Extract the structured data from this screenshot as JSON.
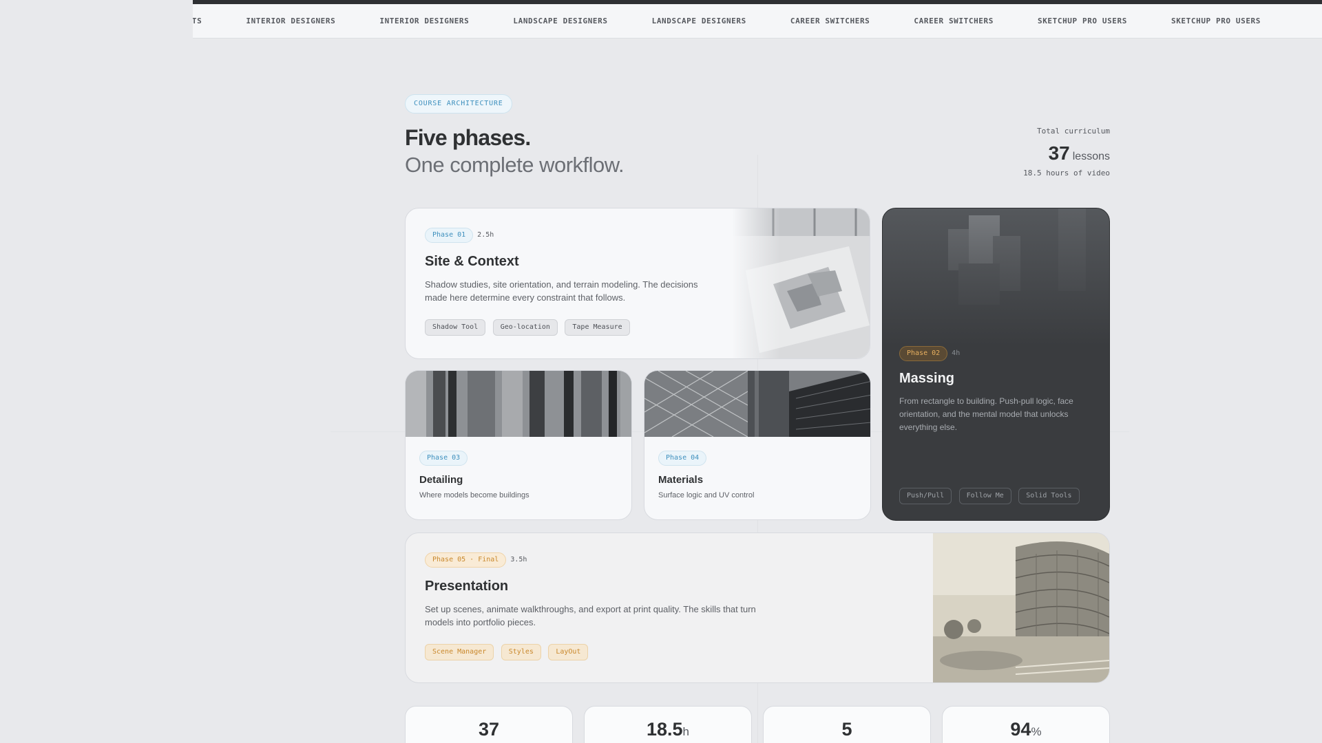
{
  "ticker": [
    "ITECTS",
    "INTERIOR DESIGNERS",
    "INTERIOR DESIGNERS",
    "LANDSCAPE DESIGNERS",
    "LANDSCAPE DESIGNERS",
    "CAREER SWITCHERS",
    "CAREER SWITCHERS",
    "SKETCHUP PRO USERS",
    "SKETCHUP PRO USERS"
  ],
  "header": {
    "badge": "COURSE ARCHITECTURE",
    "title_line1": "Five phases.",
    "title_line2": "One complete workflow."
  },
  "totals": {
    "label": "Total curriculum",
    "lessons_count": "37",
    "lessons_unit": "lessons",
    "video": "18.5 hours of video"
  },
  "phases": {
    "p1": {
      "label": "Phase 01",
      "duration": "2.5h",
      "title": "Site & Context",
      "description": "Shadow studies, site orientation, and terrain modeling. The decisions made here determine every constraint that follows.",
      "tags": [
        "Shadow Tool",
        "Geo-location",
        "Tape Measure"
      ]
    },
    "p2": {
      "label": "Phase 02",
      "duration": "4h",
      "title": "Massing",
      "description": "From rectangle to building. Push-pull logic, face orientation, and the mental model that unlocks everything else.",
      "tags": [
        "Push/Pull",
        "Follow Me",
        "Solid Tools"
      ]
    },
    "p3": {
      "label": "Phase 03",
      "title": "Detailing",
      "subtitle": "Where models become buildings"
    },
    "p4": {
      "label": "Phase 04",
      "title": "Materials",
      "subtitle": "Surface logic and UV control"
    },
    "p5": {
      "label": "Phase 05 · Final",
      "duration": "3.5h",
      "title": "Presentation",
      "description": "Set up scenes, animate walkthroughs, and export at print quality. The skills that turn models into portfolio pieces.",
      "tags": [
        "Scene Manager",
        "Styles",
        "LayOut"
      ]
    }
  },
  "stats": [
    {
      "value": "37",
      "unit": ""
    },
    {
      "value": "18.5",
      "unit": "h"
    },
    {
      "value": "5",
      "unit": ""
    },
    {
      "value": "94",
      "unit": "%"
    }
  ]
}
